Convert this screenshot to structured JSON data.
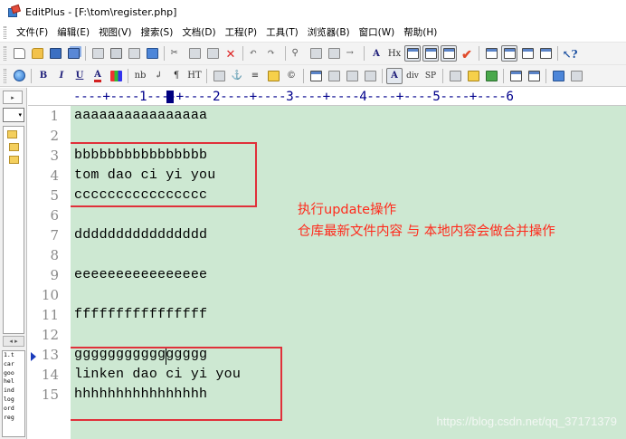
{
  "window": {
    "title": "EditPlus - [F:\\tom\\register.php]"
  },
  "menu": {
    "items": [
      "文件(F)",
      "编辑(E)",
      "视图(V)",
      "搜索(S)",
      "文档(D)",
      "工程(P)",
      "工具(T)",
      "浏览器(B)",
      "窗口(W)",
      "帮助(H)"
    ]
  },
  "toolbar2": {
    "bold": "B",
    "italic": "I",
    "underline": "U",
    "font": "A",
    "nbsp": "nb",
    "br": "↲",
    "para": "¶",
    "hr": "HT",
    "anchor_text": "A",
    "div": "div",
    "span": "SP",
    "hx": "Hx"
  },
  "ruler": {
    "text": "----+----1----+----2----+----3----+----4----+----5----+----6"
  },
  "left_panel": {
    "drive_label": "▾",
    "files": [
      "1.t",
      "car",
      "goo",
      "hel",
      "ind",
      "log",
      "ord",
      "reg"
    ]
  },
  "editor": {
    "line_numbers": [
      "1",
      "2",
      "3",
      "4",
      "5",
      "6",
      "7",
      "8",
      "9",
      "10",
      "11",
      "12",
      "13",
      "14",
      "15"
    ],
    "lines": [
      "aaaaaaaaaaaaaaaa",
      "",
      "bbbbbbbbbbbbbbbb",
      "tom dao ci yi you",
      "cccccccccccccccc",
      "",
      "dddddddddddddddd",
      "",
      "eeeeeeeeeeeeeeee",
      "",
      "ffffffffffffffff",
      "",
      "gggggggggggggggg",
      "linken dao ci yi you",
      "hhhhhhhhhhhhhhhh"
    ],
    "annotation": {
      "line1": "执行update操作",
      "line2": "仓库最新文件内容 与 本地内容会做合并操作"
    },
    "watermark": "https://blog.csdn.net/qq_37171379"
  },
  "colors": {
    "editor_bg": "#cde8d2",
    "highlight_box": "#e0303a",
    "annotation_text": "#ff2a1c",
    "ruler_text": "#00008c"
  },
  "icons": [
    "new-file-icon",
    "open-file-icon",
    "save-icon",
    "save-all-icon",
    "print-icon",
    "print-preview-icon",
    "spell-check-icon",
    "cut-icon",
    "copy-icon",
    "paste-icon",
    "delete-icon",
    "undo-icon",
    "redo-icon",
    "find-icon",
    "replace-icon",
    "globe-icon",
    "check-icon",
    "help-icon"
  ]
}
